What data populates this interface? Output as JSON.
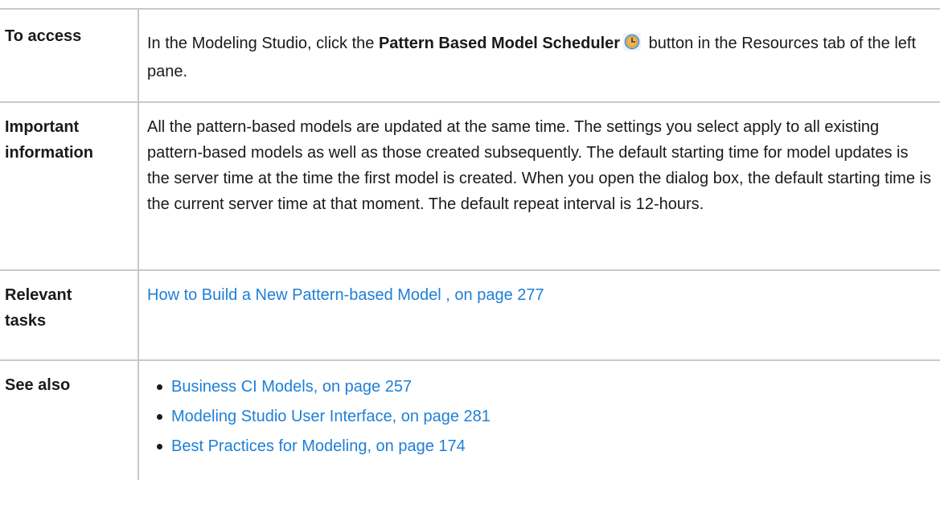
{
  "rows": {
    "access": {
      "label": "To access",
      "text_before": "In the Modeling Studio, click the ",
      "bold_button_name": "Pattern Based Model Scheduler",
      "button_icon": "clock-icon",
      "text_after": " button in the Resources tab of the left pane."
    },
    "important": {
      "label_line1": "Important",
      "label_line2": "information",
      "text": "All the pattern-based models are updated at the same time. The settings you select apply to all existing pattern-based models as well as those created subsequently. The default starting time for model updates is the server time at the time the first model is created. When you open the dialog box, the default starting time is the current server time at that moment. The default repeat interval is 12-hours."
    },
    "relevant": {
      "label_line1": "Relevant",
      "label_line2": "tasks",
      "link_text": "How to Build a New Pattern-based Model , on page 277"
    },
    "see_also": {
      "label": "See also",
      "links": [
        "Business CI Models, on page 257",
        "Modeling Studio User Interface, on page 281",
        "Best Practices for Modeling, on page 174"
      ]
    }
  },
  "colors": {
    "link": "#1e7fd6",
    "border": "#c8c8c8",
    "text": "#1a1a1a"
  }
}
